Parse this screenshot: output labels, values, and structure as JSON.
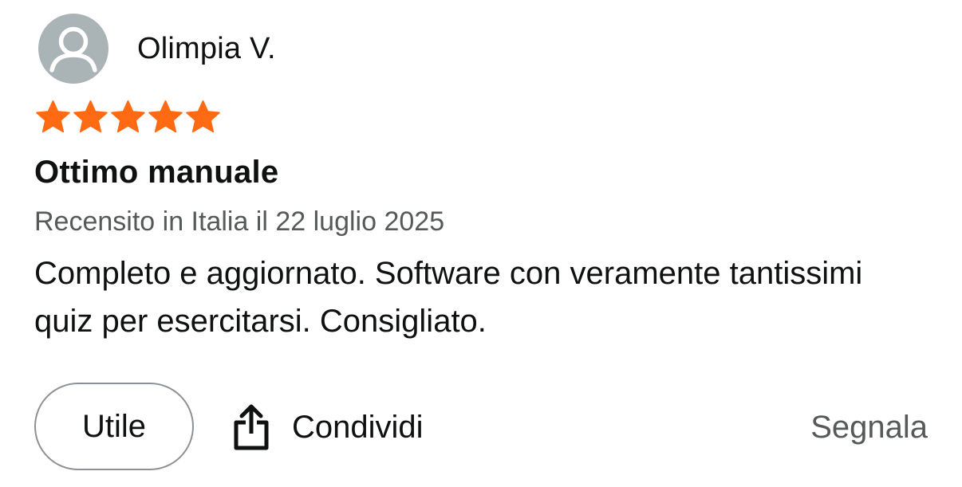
{
  "review": {
    "reviewer_name": "Olimpia V.",
    "rating": 5,
    "rating_max": 5,
    "star_color": "#ff6a13",
    "title": "Ottimo manuale",
    "meta": "Recensito in Italia il 22 luglio 2025",
    "body": "Completo e aggiornato. Software con veramente tantissimi quiz per esercitarsi. Consigliato."
  },
  "actions": {
    "useful_label": "Utile",
    "share_label": "Condividi",
    "report_label": "Segnala"
  },
  "icons": {
    "avatar": "user-avatar-icon",
    "star": "star-icon",
    "share": "share-icon"
  }
}
